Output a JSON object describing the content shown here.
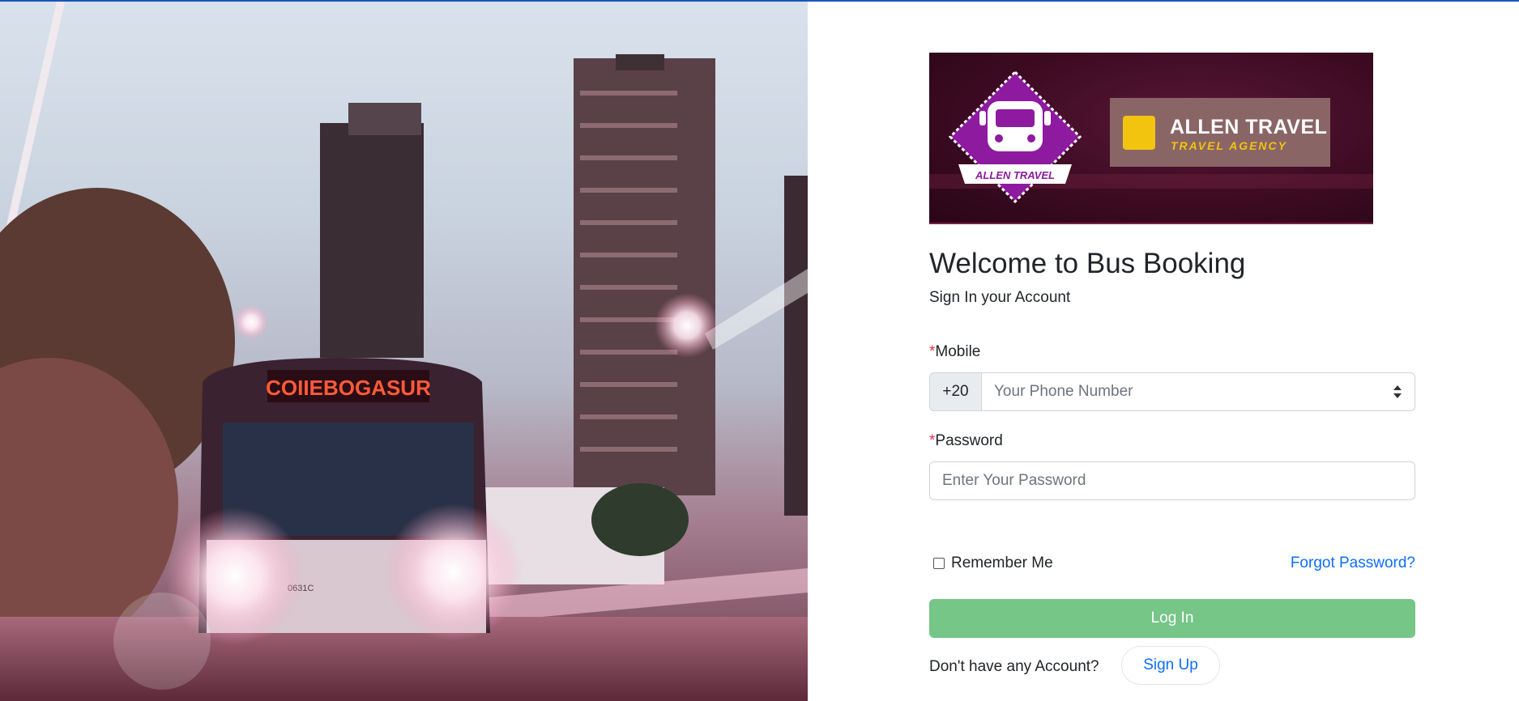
{
  "banner": {
    "badge_text": "ALLEN TRAVEL",
    "brand_name": "ALLEN TRAVEL",
    "brand_tagline": "TRAVEL AGENCY",
    "colors": {
      "badge": "#8e1aa0",
      "accent_yellow": "#f2c40f",
      "banner_bg": "#3d0b22"
    }
  },
  "hero": {
    "bus_sign": "COIIEBOGASUR",
    "plate": "0631C"
  },
  "form": {
    "title": "Welcome to Bus Booking",
    "subtitle": "Sign In your Account",
    "required_mark": "*",
    "mobile_label": "Mobile",
    "country_code": "+20",
    "phone_placeholder": "Your Phone Number",
    "password_label": "Password",
    "password_placeholder": "Enter Your Password",
    "remember_label": "Remember Me",
    "forgot_label": "Forgot Password?",
    "login_label": "Log In",
    "no_account_text": "Don't have any Account?",
    "signup_label": "Sign Up"
  },
  "colors": {
    "primary": "#0d6efd",
    "login_button": "#75c687",
    "required": "#dc3545"
  }
}
